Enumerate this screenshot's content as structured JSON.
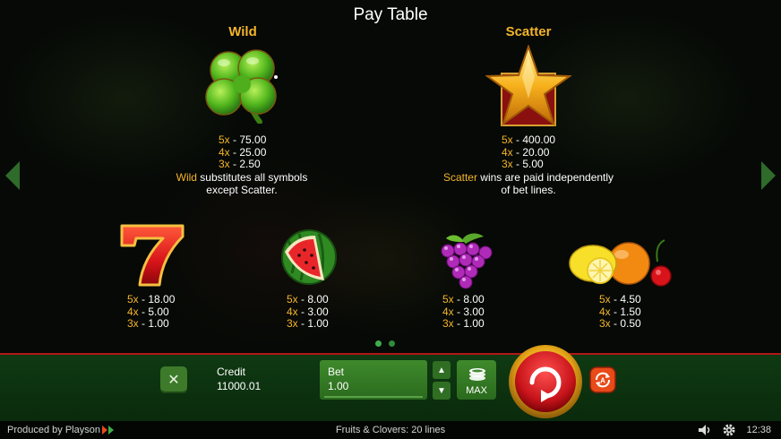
{
  "title": "Pay Table",
  "wild": {
    "name": "Wild",
    "pays": [
      {
        "mult": "5x",
        "value": "75.00"
      },
      {
        "mult": "4x",
        "value": "25.00"
      },
      {
        "mult": "3x",
        "value": "2.50"
      }
    ],
    "desc_hl": "Wild",
    "desc_rest": " substitutes all symbols",
    "desc_line2": "except Scatter."
  },
  "scatter": {
    "name": "Scatter",
    "pays": [
      {
        "mult": "5x",
        "value": "400.00"
      },
      {
        "mult": "4x",
        "value": "20.00"
      },
      {
        "mult": "3x",
        "value": "5.00"
      }
    ],
    "desc_hl": "Scatter",
    "desc_rest": " wins are paid independently",
    "desc_line2": "of bet lines."
  },
  "symbols": [
    {
      "icon": "seven-icon",
      "pays": [
        {
          "mult": "5x",
          "value": "18.00"
        },
        {
          "mult": "4x",
          "value": "5.00"
        },
        {
          "mult": "3x",
          "value": "1.00"
        }
      ]
    },
    {
      "icon": "watermelon-icon",
      "pays": [
        {
          "mult": "5x",
          "value": "8.00"
        },
        {
          "mult": "4x",
          "value": "3.00"
        },
        {
          "mult": "3x",
          "value": "1.00"
        }
      ]
    },
    {
      "icon": "grapes-icon",
      "pays": [
        {
          "mult": "5x",
          "value": "8.00"
        },
        {
          "mult": "4x",
          "value": "3.00"
        },
        {
          "mult": "3x",
          "value": "1.00"
        }
      ]
    },
    {
      "icon": "citrus-cherry-icon",
      "pays": [
        {
          "mult": "5x",
          "value": "4.50"
        },
        {
          "mult": "4x",
          "value": "1.50"
        },
        {
          "mult": "3x",
          "value": "0.50"
        }
      ]
    }
  ],
  "controls": {
    "close_glyph": "✕",
    "credit_label": "Credit",
    "credit_value": "11000.01",
    "bet_label": "Bet",
    "bet_value": "1.00",
    "bet_up_glyph": "▲",
    "bet_down_glyph": "▼",
    "max_label": "MAX"
  },
  "footer": {
    "produced_by": "Produced by Playson",
    "game_info": "Fruits & Clovers: 20 lines",
    "clock": "12:38"
  },
  "colors": {
    "accent_gold": "#f4b52a",
    "panel_green": "#0f3a12",
    "spin_red": "#c8141a"
  }
}
